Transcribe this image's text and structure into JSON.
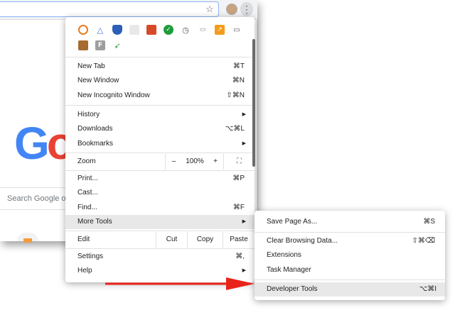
{
  "menu": {
    "new_tab": {
      "label": "New Tab",
      "shortcut": "⌘T"
    },
    "new_window": {
      "label": "New Window",
      "shortcut": "⌘N"
    },
    "new_incognito": {
      "label": "New Incognito Window",
      "shortcut": "⇧⌘N"
    },
    "history": {
      "label": "History"
    },
    "downloads": {
      "label": "Downloads",
      "shortcut": "⌥⌘L"
    },
    "bookmarks": {
      "label": "Bookmarks"
    },
    "zoom": {
      "label": "Zoom",
      "minus": "–",
      "value": "100%",
      "plus": "+"
    },
    "print": {
      "label": "Print...",
      "shortcut": "⌘P"
    },
    "cast": {
      "label": "Cast..."
    },
    "find": {
      "label": "Find...",
      "shortcut": "⌘F"
    },
    "more_tools": {
      "label": "More Tools"
    },
    "edit": {
      "label": "Edit",
      "cut": "Cut",
      "copy": "Copy",
      "paste": "Paste"
    },
    "settings": {
      "label": "Settings",
      "shortcut": "⌘,"
    },
    "help": {
      "label": "Help"
    }
  },
  "submenu": {
    "save_page": {
      "label": "Save Page As...",
      "shortcut": "⌘S"
    },
    "clear_data": {
      "label": "Clear Browsing Data...",
      "shortcut": "⇧⌘⌫"
    },
    "extensions": {
      "label": "Extensions"
    },
    "task_manager": {
      "label": "Task Manager"
    },
    "developer_tools": {
      "label": "Developer Tools",
      "shortcut": "⌥⌘I"
    }
  },
  "page": {
    "logo_first": "G",
    "logo_second": "o",
    "search_placeholder": "Search Google or"
  },
  "icons": {
    "submenu_arrow": "▶",
    "fullscreen": "⛶",
    "star": "☆",
    "kebab": "⋮"
  },
  "colors": {
    "annotation_arrow": "#e8231a",
    "highlight": "#e8e8e8"
  }
}
